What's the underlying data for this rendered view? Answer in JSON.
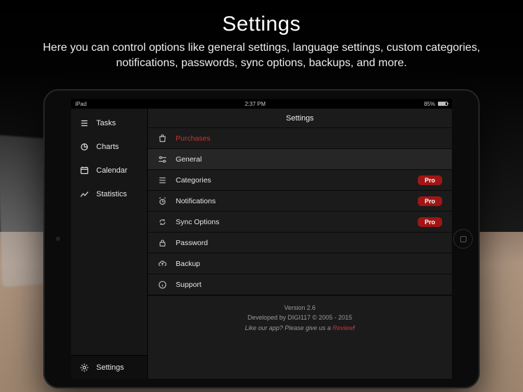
{
  "promo": {
    "title": "Settings",
    "subtitle": "Here you can control options like general settings, language settings, custom categories, notifications, passwords, sync options, backups, and more."
  },
  "statusbar": {
    "device": "iPad",
    "time": "2:37 PM",
    "battery": "85%"
  },
  "sidebar": {
    "items": [
      {
        "label": "Tasks"
      },
      {
        "label": "Charts"
      },
      {
        "label": "Calendar"
      },
      {
        "label": "Statistics"
      }
    ],
    "settings_label": "Settings"
  },
  "settings": {
    "header_title": "Settings",
    "purchases_label": "Purchases",
    "rows": {
      "general": "General",
      "categories": "Categories",
      "notifications": "Notifications",
      "sync": "Sync Options",
      "password": "Password",
      "backup": "Backup",
      "support": "Support"
    },
    "pro_badge": "Pro",
    "footer": {
      "version": "Version 2.6",
      "developer": "Developed by DIGI117 © 2005 - 2015",
      "review_prefix": "Like our app? Please give us a ",
      "review_word": "Review",
      "review_suffix": "!"
    }
  }
}
